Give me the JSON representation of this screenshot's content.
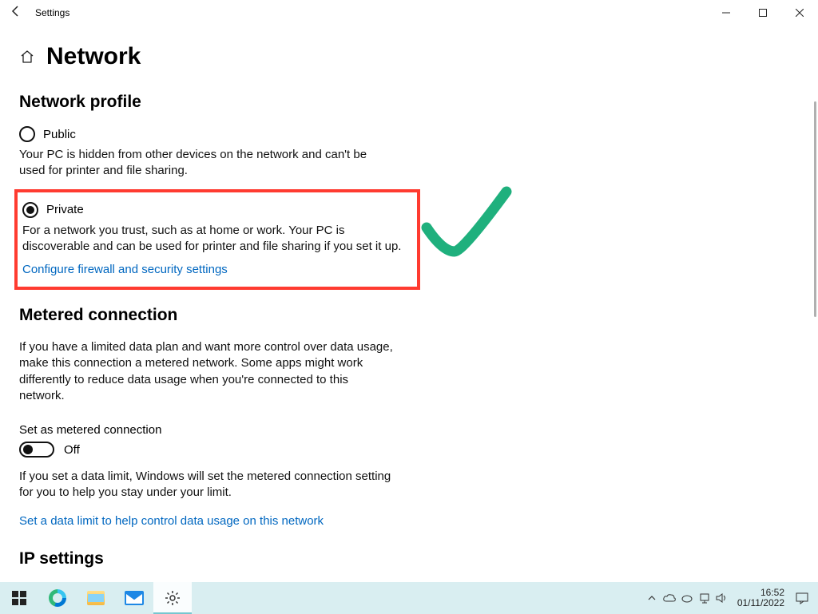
{
  "titlebar": {
    "title": "Settings"
  },
  "page": {
    "heading": "Network",
    "profile": {
      "heading": "Network profile",
      "public": {
        "label": "Public",
        "desc": "Your PC is hidden from other devices on the network and can't be used for printer and file sharing."
      },
      "private": {
        "label": "Private",
        "desc": "For a network you trust, such as at home or work. Your PC is discoverable and can be used for printer and file sharing if you set it up.",
        "link": "Configure firewall and security settings"
      }
    },
    "metered": {
      "heading": "Metered connection",
      "desc": "If you have a limited data plan and want more control over data usage, make this connection a metered network. Some apps might work differently to reduce data usage when you're connected to this network.",
      "toggle_label": "Set as metered connection",
      "toggle_value": "Off",
      "limit_desc": "If you set a data limit, Windows will set the metered connection setting for you to help you stay under your limit.",
      "limit_link": "Set a data limit to help control data usage on this network"
    },
    "ip": {
      "heading": "IP settings"
    }
  },
  "taskbar": {
    "clock_time": "16:52",
    "clock_date": "01/11/2022"
  },
  "colors": {
    "accent": "#0067c0",
    "highlight": "#ff3b30",
    "check": "#1fb07d"
  }
}
